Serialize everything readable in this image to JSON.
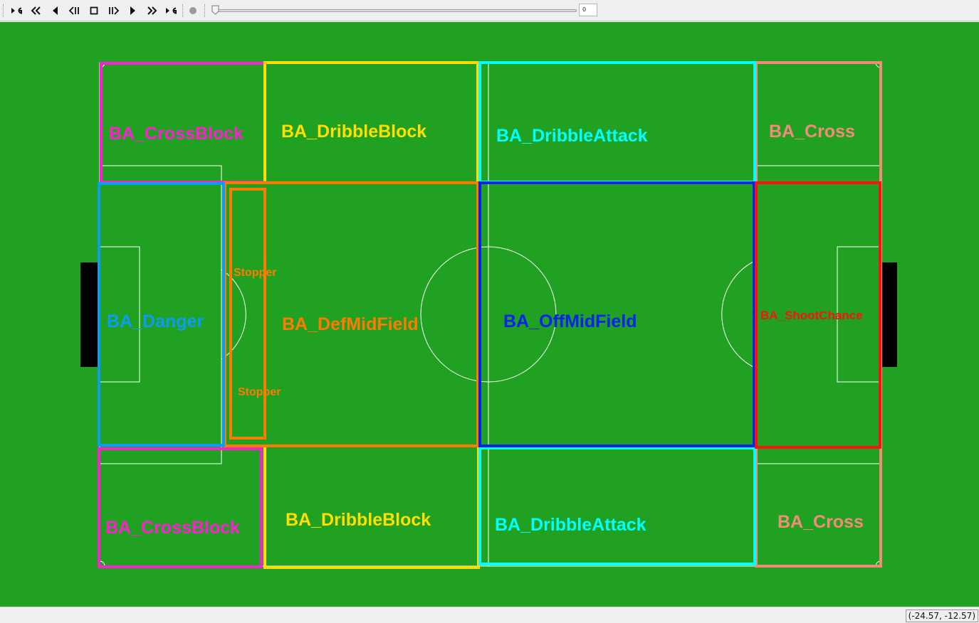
{
  "toolbar": {
    "buttons": [
      {
        "name": "go-first-button",
        "icon": "skip-to-start-icon"
      },
      {
        "name": "fast-rewind-button",
        "icon": "double-chevron-left-icon"
      },
      {
        "name": "step-back-button",
        "icon": "triangle-left-icon"
      },
      {
        "name": "play-backward-button",
        "icon": "bar-triangle-left-icon"
      },
      {
        "name": "stop-button",
        "icon": "square-stop-icon"
      },
      {
        "name": "play-forward-button",
        "icon": "bar-triangle-right-icon"
      },
      {
        "name": "step-forward-button",
        "icon": "triangle-right-icon"
      },
      {
        "name": "fast-forward-button",
        "icon": "double-chevron-right-icon"
      },
      {
        "name": "go-last-button",
        "icon": "skip-to-end-icon"
      },
      {
        "name": "record-button",
        "icon": "record-dot-icon"
      }
    ],
    "slider_position": 0,
    "frame_value": "0"
  },
  "zones": {
    "crossblock_top": {
      "label": "BA_CrossBlock",
      "color": "#ff1fd2"
    },
    "dribbleblock_top": {
      "label": "BA_DribbleBlock",
      "color": "#ffdf00"
    },
    "dribbleattack_top": {
      "label": "BA_DribbleAttack",
      "color": "#00ffff"
    },
    "cross_top": {
      "label": "BA_Cross",
      "color": "#f28c77"
    },
    "danger": {
      "label": "BA_Danger",
      "color": "#0c9cf0"
    },
    "defmidfield": {
      "label": "BA_DefMidField",
      "color": "#ff7a00"
    },
    "stopper_top": {
      "label": "Stopper",
      "color": "#ff7a00"
    },
    "stopper_bottom": {
      "label": "Stopper",
      "color": "#ff7a00"
    },
    "offmidfield": {
      "label": "BA_OffMidField",
      "color": "#0022ee"
    },
    "shootchance": {
      "label": "BA_ShootChance",
      "color": "#ff1010"
    },
    "crossblock_bottom": {
      "label": "BA_CrossBlock",
      "color": "#ff1fd2"
    },
    "dribbleblock_bottom": {
      "label": "BA_DribbleBlock",
      "color": "#ffdf00"
    },
    "dribbleattack_bottom": {
      "label": "BA_DribbleAttack",
      "color": "#00ffff"
    },
    "cross_bottom": {
      "label": "BA_Cross",
      "color": "#f28c77"
    }
  },
  "colors": {
    "field": "#21a121",
    "line": "#ffffff",
    "goal": "#000000"
  },
  "status": {
    "coordinates": "(-24.57, -12.57)"
  }
}
